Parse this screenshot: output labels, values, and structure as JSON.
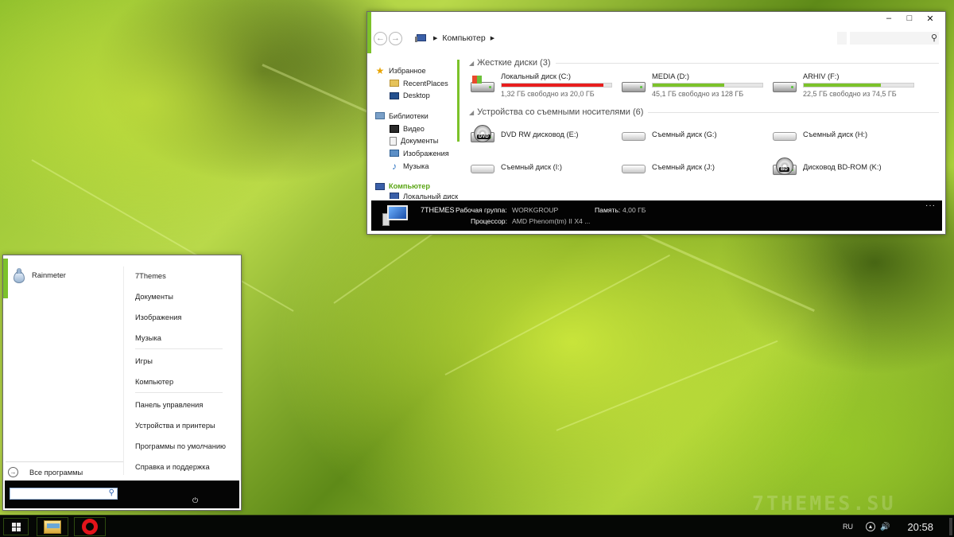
{
  "explorer": {
    "title_controls": [
      "minimize",
      "maximize",
      "close"
    ],
    "breadcrumb": "Компьютер",
    "nav": {
      "favorites": {
        "label": "Избранное",
        "items": [
          "RecentPlaces",
          "Desktop"
        ]
      },
      "libraries": {
        "label": "Библиотеки",
        "items": [
          "Видео",
          "Документы",
          "Изображения",
          "Музыка"
        ]
      },
      "computer": {
        "label": "Компьютер",
        "items": [
          "Локальный диск"
        ]
      }
    },
    "groups": {
      "hdd_header": "Жесткие диски (3)",
      "removable_header": "Устройства со съемными носителями (6)"
    },
    "hard_drives": [
      {
        "name": "Локальный диск (C:)",
        "free_text": "1,32 ГБ свободно из 20,0 ГБ",
        "used_fraction": 0.93,
        "bar_color": "#e81e1e"
      },
      {
        "name": "MEDIA (D:)",
        "free_text": "45,1 ГБ свободно из 128 ГБ",
        "used_fraction": 0.65,
        "bar_color": "#7cc22a"
      },
      {
        "name": "ARHIV (F:)",
        "free_text": "22,5 ГБ свободно из 74,5 ГБ",
        "used_fraction": 0.7,
        "bar_color": "#7cc22a"
      }
    ],
    "removable": [
      {
        "name": "DVD RW дисковод (E:)",
        "kind": "dvd",
        "tag": "DVD"
      },
      {
        "name": "Съемный диск (G:)",
        "kind": "removable"
      },
      {
        "name": "Съемный диск (H:)",
        "kind": "removable"
      },
      {
        "name": "Съемный диск (I:)",
        "kind": "removable"
      },
      {
        "name": "Съемный диск (J:)",
        "kind": "removable"
      },
      {
        "name": "Дисковод BD-ROM (K:)",
        "kind": "bd",
        "tag": "BD"
      }
    ],
    "details": {
      "computer_name": "7THEMES",
      "workgroup_label": "Рабочая группа:",
      "workgroup_value": "WORKGROUP",
      "memory_label": "Память:",
      "memory_value": "4,00 ГБ",
      "cpu_label": "Процессор:",
      "cpu_value": "AMD Phenom(tm) II X4 ...",
      "more": "···"
    }
  },
  "start_menu": {
    "pinned": "Rainmeter",
    "right_items": [
      "7Themes",
      "Документы",
      "Изображения",
      "Музыка",
      "Игры",
      "Компьютер",
      "Панель управления",
      "Устройства и принтеры",
      "Программы по умолчанию",
      "Справка и поддержка"
    ],
    "all_programs": "Все программы",
    "search_placeholder": ""
  },
  "taskbar": {
    "language": "RU",
    "time": "20:58"
  },
  "watermark": "7THEMES.SU",
  "colors": {
    "accent": "#7cc22a",
    "critical": "#e81e1e"
  }
}
